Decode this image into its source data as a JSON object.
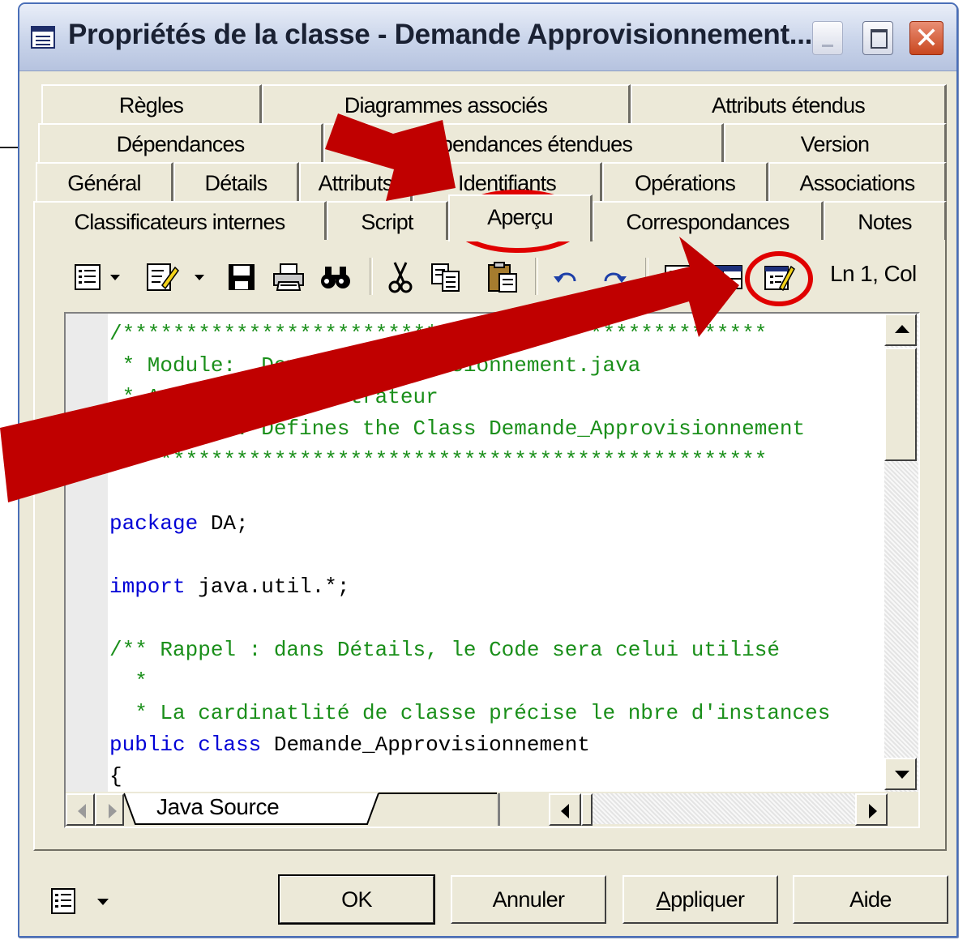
{
  "window": {
    "title": "Propriétés de la classe - Demande Approvisionnement...",
    "controls": {
      "minimize": "minimize",
      "maximize": "maximize",
      "close": "close"
    }
  },
  "tabs": {
    "row1": [
      "Règles",
      "Diagrammes associés",
      "Attributs étendus"
    ],
    "row2": [
      "Dépendances",
      "Dépendances étendues",
      "Version"
    ],
    "row3": [
      "Général",
      "Détails",
      "Attributs",
      "Identifiants",
      "Opérations",
      "Associations"
    ],
    "row4": [
      "Classificateurs internes",
      "Script",
      "Aperçu",
      "Correspondances",
      "Notes"
    ],
    "active": "Aperçu"
  },
  "toolbar": {
    "icons": [
      "properties-menu-icon",
      "edit-menu-icon",
      "save-icon",
      "print-icon",
      "find-icon",
      "cut-icon",
      "copy-icon",
      "paste-icon",
      "undo-icon",
      "redo-icon",
      "view-icon",
      "grid-icon",
      "edit-with-icon"
    ],
    "status": "Ln 1, Col"
  },
  "editor": {
    "lines": [
      {
        "cls": "c-comment",
        "text": "/***************************************************"
      },
      {
        "cls": "c-comment",
        "text": " * Module:  Demande_Approvisionnement.java"
      },
      {
        "cls": "c-comment",
        "text": " * Author:  Administrateur"
      },
      {
        "cls": "c-comment",
        "text": " * Purpose: Defines the Class Demande_Approvisionnement"
      },
      {
        "cls": "c-comment",
        "text": " ***************************************************"
      },
      {
        "cls": "c-plain",
        "text": ""
      },
      {
        "cls": "mixed",
        "kw": "package",
        "rest": " DA;"
      },
      {
        "cls": "c-plain",
        "text": ""
      },
      {
        "cls": "mixed",
        "kw": "import",
        "rest": " java.util.*;"
      },
      {
        "cls": "c-plain",
        "text": ""
      },
      {
        "cls": "c-comment",
        "text": "/** Rappel : dans Détails, le Code sera celui utilisé"
      },
      {
        "cls": "c-comment",
        "text": "  *"
      },
      {
        "cls": "c-comment",
        "text": "  * La cardinatlité de classe précise le nbre d'instances"
      },
      {
        "cls": "mixed",
        "kw": "public class",
        "rest": " Demande_Approvisionnement"
      },
      {
        "cls": "c-plain",
        "text": "{"
      }
    ],
    "sheet_tab": "Java Source"
  },
  "buttons": {
    "ok": "OK",
    "cancel": "Annuler",
    "apply_prefix": "A",
    "apply_rest": "ppliquer",
    "help": "Aide"
  },
  "annotation_colors": {
    "arrow": "#c00000",
    "circle": "#e00000"
  }
}
